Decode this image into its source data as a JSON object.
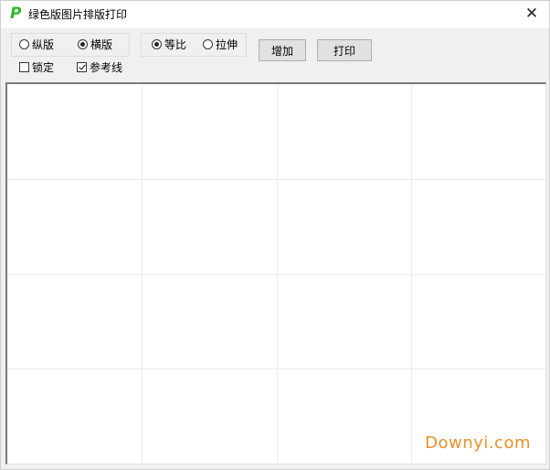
{
  "window": {
    "title": "绿色版图片排版打印",
    "app_icon_glyph": "P",
    "close_glyph": "✕"
  },
  "layout_group": {
    "portrait_label": "纵版",
    "landscape_label": "横版",
    "selected": "landscape",
    "lock_label": "锁定",
    "lock_checked": false,
    "guides_label": "参考线",
    "guides_checked": true
  },
  "scale_group": {
    "proportional_label": "等比",
    "stretch_label": "拉伸",
    "selected": "proportional"
  },
  "toolbar": {
    "add_label": "增加",
    "print_label": "打印"
  },
  "canvas": {
    "grid_columns": 4,
    "grid_rows": 4
  },
  "watermark": {
    "text": "Downyi.com"
  },
  "colors": {
    "accent_icon": "#2eb82e",
    "watermark": "#e8912c"
  }
}
